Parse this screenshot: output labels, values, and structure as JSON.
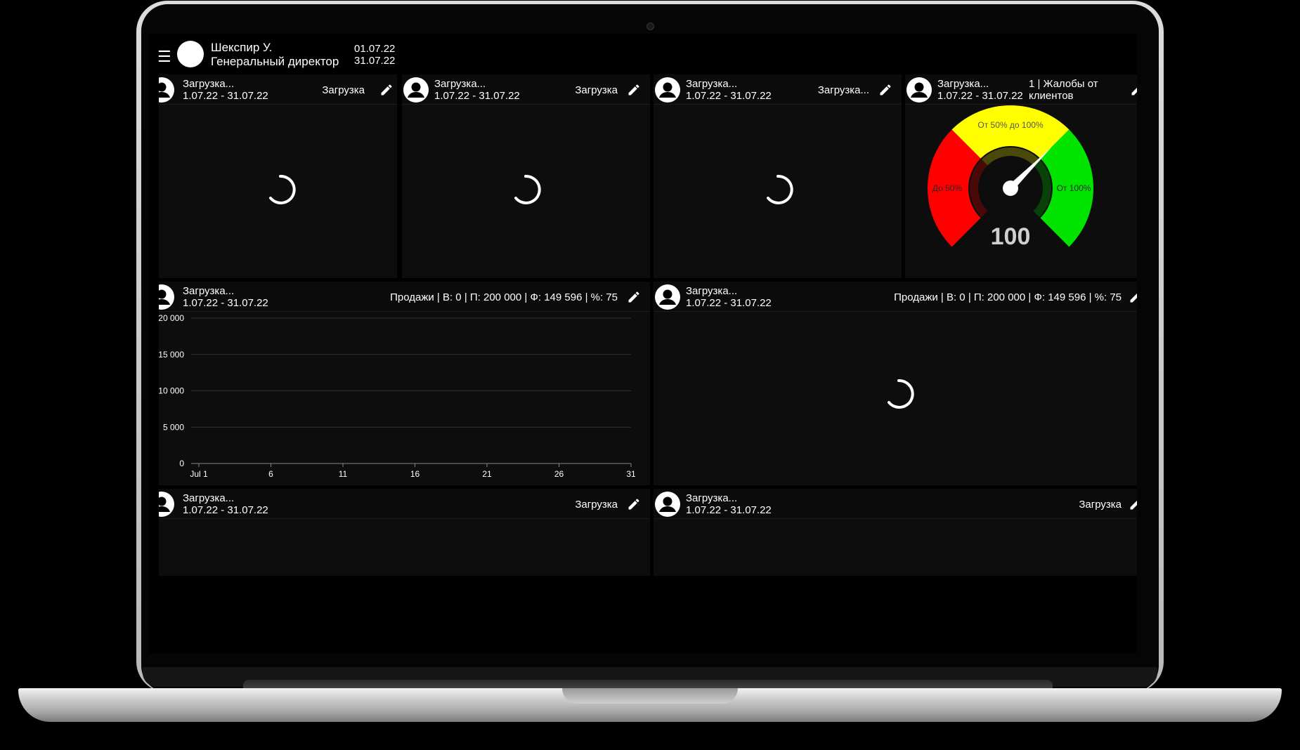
{
  "header": {
    "menu_icon": "hamburger-icon",
    "user_name": "Шекспир У.",
    "user_role": "Генеральный директор",
    "date_from": "01.07.22",
    "date_to": "31.07.22"
  },
  "widgets": {
    "w1": {
      "title": "Загрузка...",
      "period": "1.07.22 - 31.07.22",
      "status": "Загрузка"
    },
    "w2": {
      "title": "Загрузка...",
      "period": "1.07.22 - 31.07.22",
      "status": "Загрузка"
    },
    "w3": {
      "title": "Загрузка...",
      "period": "1.07.22 - 31.07.22",
      "status": "Загрузка..."
    },
    "w4": {
      "title": "Загрузка...",
      "period": "1.07.22 - 31.07.22",
      "status_line1": "1 | Жалобы от",
      "status_line2": "клиентов"
    },
    "w5": {
      "title": "Загрузка...",
      "period": "1.07.22 - 31.07.22",
      "status": "Продажи | В: 0 | П: 200 000 | Ф: 149 596 | %: 75"
    },
    "w6": {
      "title": "Загрузка...",
      "period": "1.07.22 - 31.07.22",
      "status": "Продажи | В: 0 | П: 200 000 | Ф: 149 596 | %: 75"
    },
    "w7": {
      "title": "Загрузка...",
      "period": "1.07.22 - 31.07.22",
      "status": "Загрузка"
    },
    "w8": {
      "title": "Загрузка...",
      "period": "1.07.22 - 31.07.22",
      "status": "Загрузка"
    }
  },
  "gauge": {
    "value": 100,
    "value_label": "100",
    "min": 0,
    "max": 150,
    "zones": [
      {
        "label": "До 50%",
        "from": 0,
        "to": 50,
        "color": "#ff0000"
      },
      {
        "label": "От 50% до 100%",
        "from": 50,
        "to": 100,
        "color": "#ffff00"
      },
      {
        "label": "От 100%",
        "from": 100,
        "to": 150,
        "color": "#00e400"
      }
    ]
  },
  "chart_data": {
    "type": "line",
    "x_ticks": [
      "Jul 1",
      "6",
      "11",
      "16",
      "21",
      "26",
      "31"
    ],
    "x_range": [
      1,
      31
    ],
    "y_ticks": [
      "0",
      "5 000",
      "10 000",
      "15 000",
      "20 000"
    ],
    "ylim": [
      0,
      20000
    ],
    "series": [],
    "grid": true
  },
  "colors": {
    "background": "#000000",
    "widget_bg": "#0d0d0d",
    "text": "#ffffff",
    "grid": "#333333"
  }
}
